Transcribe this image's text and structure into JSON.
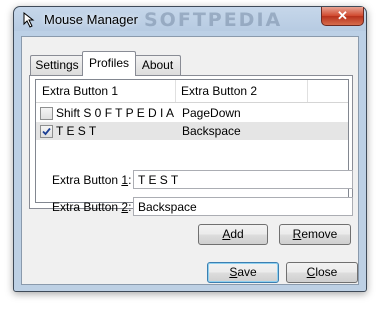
{
  "window": {
    "title": "Mouse Manager",
    "watermark": "SOFTPEDIA",
    "close_glyph": "✕"
  },
  "tabs": [
    {
      "label": "Settings"
    },
    {
      "label": "Profiles"
    },
    {
      "label": "About"
    }
  ],
  "list": {
    "columns": [
      "Extra Button 1",
      "Extra Button 2"
    ],
    "rows": [
      {
        "checked": false,
        "button1": "Shift S 0 F T P E D I A",
        "button2": "PageDown"
      },
      {
        "checked": true,
        "button1": "T E S T",
        "button2": "Backspace"
      }
    ]
  },
  "form": {
    "extra_button_1_label": "Extra Button ",
    "extra_button_1_key": "1",
    "extra_button_1_colon": ":",
    "extra_button_1_value": "T E S T",
    "extra_button_2_label": "Extra Button ",
    "extra_button_2_key": "2",
    "extra_button_2_colon": ":",
    "extra_button_2_value": "Backspace"
  },
  "buttons": {
    "add_key": "A",
    "add_rest": "dd",
    "remove_key": "R",
    "remove_rest": "emove",
    "save_key": "S",
    "save_rest": "ave",
    "close_key": "C",
    "close_rest": "lose"
  },
  "colors": {
    "title_bar": "#b7cbe2",
    "close_button": "#d0482d",
    "selected_row": "#e5e5e5"
  },
  "icons": {
    "app": "mouse-cursor-icon",
    "close": "close-icon",
    "checkbox_checked": "checkmark-icon"
  }
}
